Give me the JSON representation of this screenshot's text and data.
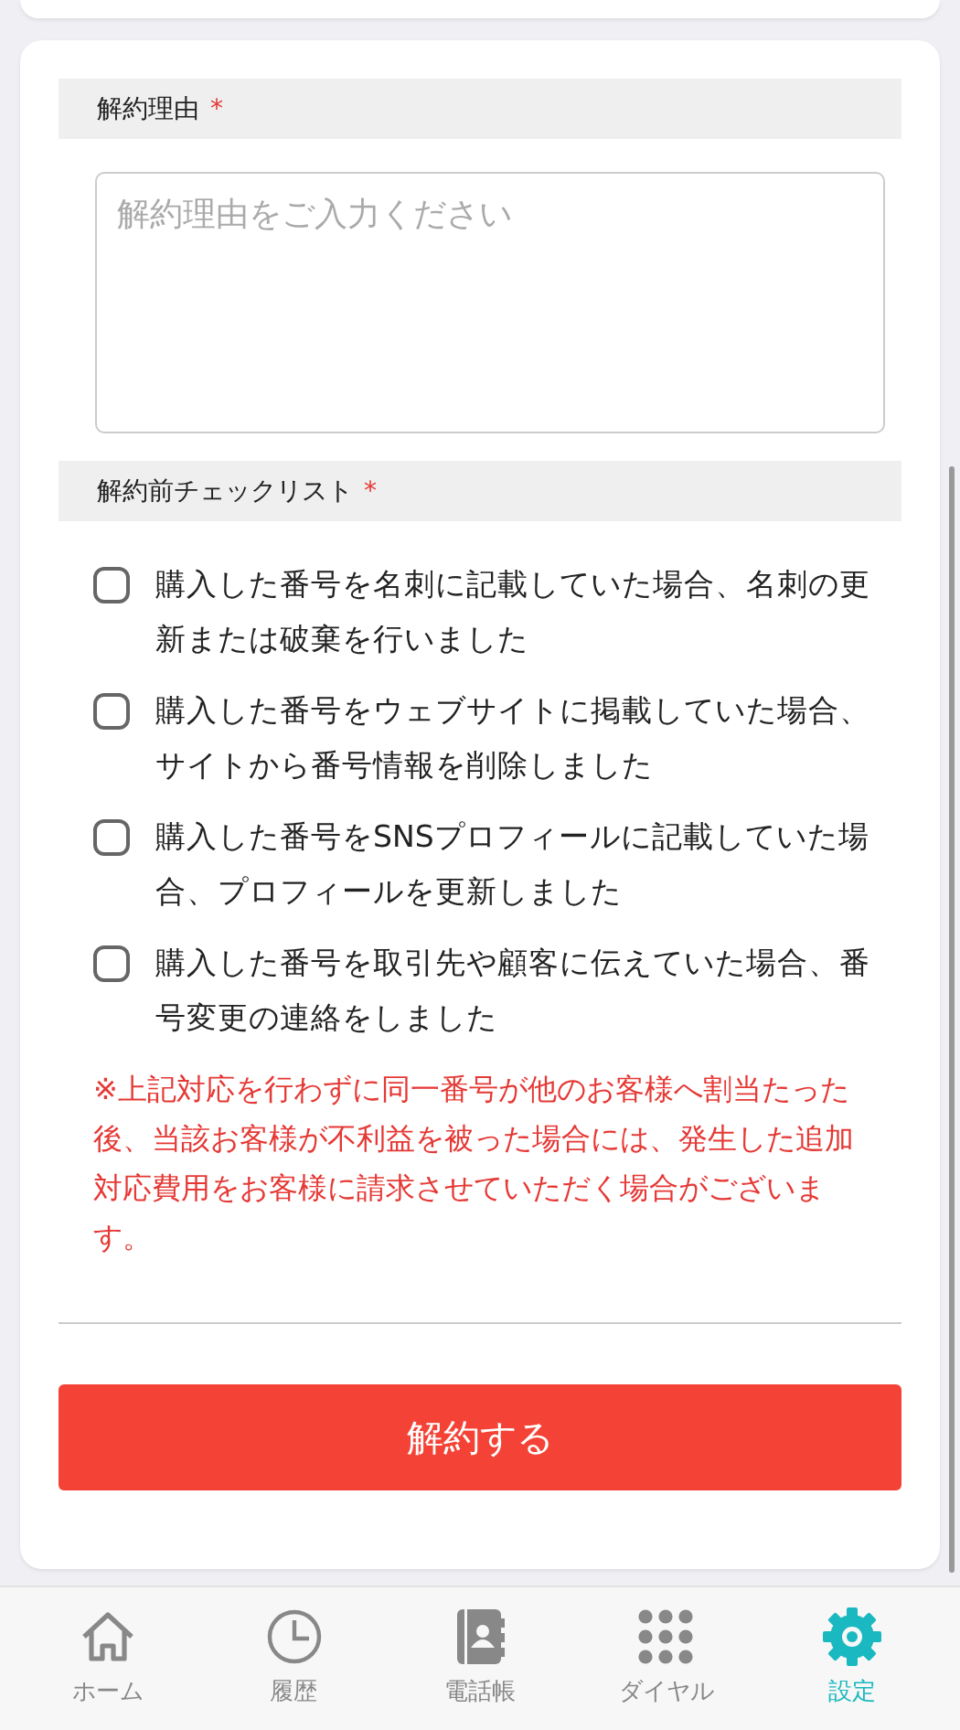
{
  "form": {
    "reason": {
      "label": "解約理由",
      "required_mark": "*",
      "placeholder": "解約理由をご入力ください"
    },
    "checklist": {
      "label": "解約前チェックリスト",
      "required_mark": "*",
      "items": [
        {
          "text": "購入した番号を名刺に記載していた場合、名刺の更新または破棄を行いました",
          "checked": false
        },
        {
          "text": "購入した番号をウェブサイトに掲載していた場合、サイトから番号情報を削除しました",
          "checked": false
        },
        {
          "text": "購入した番号をSNSプロフィールに記載していた場合、プロフィールを更新しました",
          "checked": false
        },
        {
          "text": "購入した番号を取引先や顧客に伝えていた場合、番号変更の連絡をしました",
          "checked": false
        }
      ]
    },
    "note": "※上記対応を行わずに同一番号が他のお客様へ割当たった後、当該お客様が不利益を被った場合には、発生した追加対応費用をお客様に請求させていただく場合がございます。",
    "submit": "解約する"
  },
  "tab_bar": [
    {
      "kind": "home",
      "label": "ホーム",
      "selected": false
    },
    {
      "kind": "history",
      "label": "履歴",
      "selected": false
    },
    {
      "kind": "contacts",
      "label": "電話帳",
      "selected": false
    },
    {
      "kind": "dial",
      "label": "ダイヤル",
      "selected": false
    },
    {
      "kind": "settings",
      "label": "設定",
      "selected": true
    }
  ]
}
